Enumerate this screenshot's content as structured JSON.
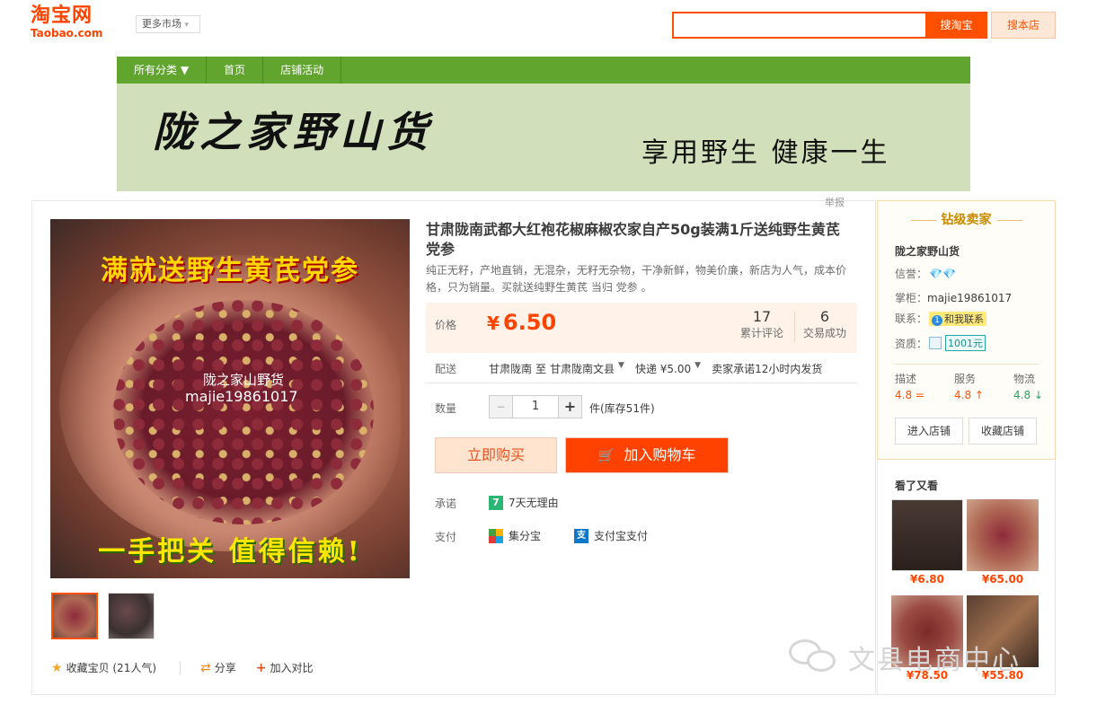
{
  "header": {
    "logo_cn": "淘宝网",
    "logo_en": "Taobao.com",
    "market_label": "更多市场",
    "search_value": "",
    "search_button": "搜淘宝",
    "shop_search_button": "搜本店",
    "accent_color": "#ff5000"
  },
  "shop_nav": {
    "items": [
      {
        "label": "所有分类 ▼"
      },
      {
        "label": "首页"
      },
      {
        "label": "店铺活动"
      }
    ],
    "color": "#61a52e"
  },
  "banner": {
    "shop_name": "陇之家野山货",
    "slogan": "享用野生 健康一生"
  },
  "report_link": "举报",
  "product_image": {
    "top_text": "满就送野生黄芪党参",
    "watermark_line1": "陇之家山野货",
    "watermark_line2": "majie19861017",
    "bottom_text": "一手把关 值得信赖!"
  },
  "product": {
    "title": "甘肃陇南武都大红袍花椒麻椒农家自产50g装满1斤送纯野生黄芪党参",
    "subtitle": "纯正无籽，产地直销，无混杂，无籽无杂物，干净新鲜，物美价廉，新店为人气，成本价格，只为销量。买就送纯野生黄芪 当归 党参 。",
    "price_label": "价格",
    "currency": "¥",
    "price": "6.50",
    "reviews_count": "17",
    "reviews_label": "累计评论",
    "deals_count": "6",
    "deals_label": "交易成功",
    "shipping_label": "配送",
    "ship_from": "甘肃陇南",
    "ship_to_word": "至",
    "ship_to": "甘肃陇南文县",
    "express": "快递 ¥5.00",
    "ship_promise": "卖家承诺12小时内发货",
    "qty_label": "数量",
    "qty_minus": "−",
    "qty_value": "1",
    "qty_plus": "+",
    "stock": "件(库存51件)",
    "buy_now": "立即购买",
    "add_to_cart": "加入购物车",
    "promise_label": "承诺",
    "promise_badge": "7",
    "promise_text": "7天无理由",
    "pay_label": "支付",
    "pay_1": "集分宝",
    "pay_2": "支付宝支付",
    "pay_2_icon": "支"
  },
  "actions": {
    "favorite": "收藏宝贝 (21人气)",
    "share": "分享",
    "compare": "加入对比"
  },
  "seller": {
    "header": "钻级卖家",
    "shop_name": "陇之家野山货",
    "credit_label": "信誉：",
    "diamonds": "💎💎",
    "keeper_label": "掌柜：",
    "keeper": "majie19861017",
    "contact_label": "联系：",
    "contact_badge": "1",
    "contact_button": "和我联系",
    "qual_label": "资质：",
    "deposit": "1001元",
    "score_desc_label": "描述",
    "score_desc": "4.8 =",
    "score_service_label": "服务",
    "score_service": "4.8 ↑",
    "score_logistics_label": "物流",
    "score_logistics": "4.8 ↓",
    "enter_shop": "进入店铺",
    "fav_shop": "收藏店铺"
  },
  "also_viewed": {
    "header": "看了又看",
    "items": [
      {
        "price": "¥6.80"
      },
      {
        "price": "¥65.00"
      },
      {
        "price": "¥78.50"
      },
      {
        "price": "¥55.80"
      }
    ]
  },
  "watermark_text": "文县电商中心"
}
